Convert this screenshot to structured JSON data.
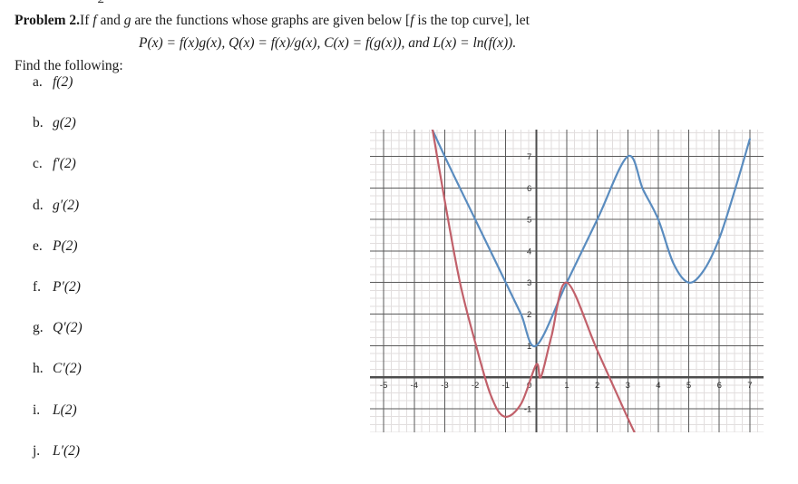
{
  "document": {
    "cut_off_top_fragment": "2",
    "problem_label": "Problem 2.",
    "problem_text_1": "If ",
    "problem_text_f": "f",
    "problem_text_2": " and ",
    "problem_text_g": "g",
    "problem_text_3": " are the functions whose graphs are given below [",
    "problem_text_f2": "f",
    "problem_text_4": " is the top curve], let",
    "definitions": "P(x) = f(x)g(x), Q(x) = f(x)/g(x), C(x) = f(g(x)), and L(x) = ln(f(x)).",
    "find_following": "Find the following:"
  },
  "questions": [
    {
      "label": "a.",
      "expr": "f(2)"
    },
    {
      "label": "b.",
      "expr": "g(2)"
    },
    {
      "label": "c.",
      "expr": "f′(2)"
    },
    {
      "label": "d.",
      "expr": "g′(2)"
    },
    {
      "label": "e.",
      "expr": "P(2)"
    },
    {
      "label": "f.",
      "expr": "P′(2)"
    },
    {
      "label": "g.",
      "expr": "Q′(2)"
    },
    {
      "label": "h.",
      "expr": "C′(2)"
    },
    {
      "label": "i.",
      "expr": "L(2)"
    },
    {
      "label": "j.",
      "expr": "L′(2)"
    }
  ],
  "colors": {
    "curve_f": "#5a8cbf",
    "curve_g": "#c1606a",
    "axis": "#4d4d4d",
    "grid_major": "#5a5a5a",
    "grid_minor": "#e2dede",
    "text": "#1a1a1a"
  },
  "chart_data": {
    "type": "line",
    "title": "",
    "xlabel": "",
    "ylabel": "",
    "xlim": [
      -5.45,
      7.45
    ],
    "ylim": [
      -1.75,
      7.85
    ],
    "grid": true,
    "grid_major_step": 1,
    "grid_minor_step": 0.25,
    "legend": "none",
    "x_ticks": [
      -5,
      -4,
      -3,
      -2,
      -1,
      0,
      1,
      2,
      3,
      4,
      5,
      6,
      7
    ],
    "x_tick_labels": [
      "-5",
      "-4",
      "-3",
      "-2",
      "-1",
      "0",
      "1",
      "2",
      "3",
      "4",
      "5",
      "6",
      "7"
    ],
    "y_ticks": [
      -1,
      1,
      2,
      3,
      4,
      5,
      6,
      7
    ],
    "y_tick_labels": [
      "-1",
      "1",
      "2",
      "3",
      "4",
      "5",
      "6",
      "7"
    ],
    "series": [
      {
        "name": "f",
        "color": "#5a8cbf",
        "description": "top curve: V-shaped piecewise-linear from upper-left down to vertex (0,1), up to corner peak (3,7), then parabola with minimum (5,3) rising to upper right",
        "points": [
          [
            -3.95,
            9.0
          ],
          [
            -3.0,
            7.0
          ],
          [
            -2.0,
            5.0
          ],
          [
            -1.0,
            3.0
          ],
          [
            -0.5,
            2.0
          ],
          [
            0.0,
            1.0
          ],
          [
            1.0,
            3.0
          ],
          [
            2.0,
            5.0
          ],
          [
            3.0,
            7.0
          ],
          [
            3.5,
            5.95
          ],
          [
            4.0,
            5.0
          ],
          [
            4.5,
            3.6
          ],
          [
            5.0,
            3.0
          ],
          [
            5.5,
            3.4
          ],
          [
            6.0,
            4.4
          ],
          [
            6.5,
            5.9
          ],
          [
            7.0,
            7.55
          ]
        ]
      },
      {
        "name": "g",
        "color": "#c1606a",
        "description": "bottom curve: steep parabola on the left with minimum near (-1.05,-1.25), rising through (0.15,0) to shared corner (1,3), then straight line descending with slope about -2.2",
        "points": [
          [
            -3.6,
            9.0
          ],
          [
            -3.0,
            5.6
          ],
          [
            -2.5,
            3.0
          ],
          [
            -2.0,
            1.1
          ],
          [
            -1.5,
            -0.55
          ],
          [
            -1.05,
            -1.25
          ],
          [
            -0.5,
            -0.85
          ],
          [
            0.0,
            0.4
          ],
          [
            0.15,
            0.0
          ],
          [
            0.5,
            1.3
          ],
          [
            1.0,
            3.0
          ],
          [
            2.0,
            0.85
          ],
          [
            3.0,
            -1.3
          ],
          [
            3.45,
            -2.2
          ]
        ]
      }
    ]
  }
}
